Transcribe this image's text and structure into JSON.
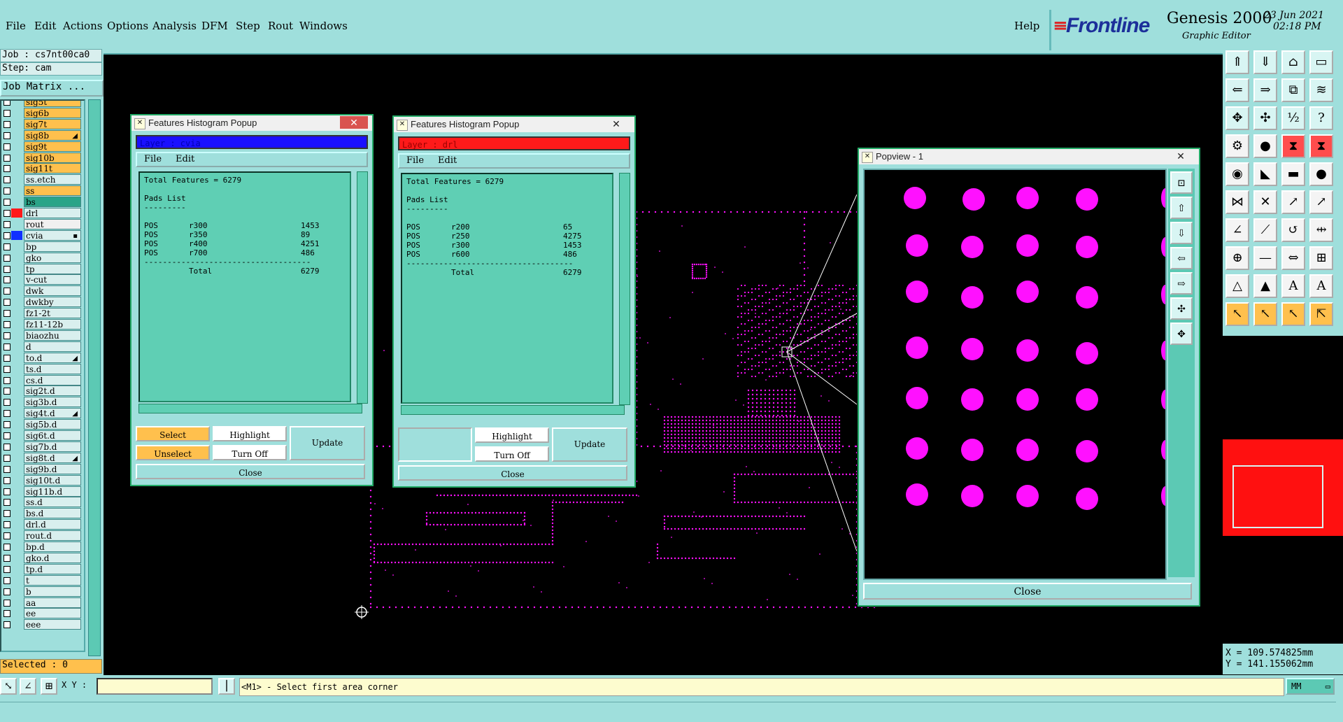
{
  "menu": {
    "items": [
      "File",
      "Edit",
      "Actions",
      "Options",
      "Analysis",
      "DFM",
      "Step",
      "Rout",
      "Windows"
    ],
    "help": "Help"
  },
  "brand": {
    "logo": "Frontline",
    "product": "Genesis 2000",
    "subtitle": "Graphic Editor",
    "date": "23 Jun 2021",
    "time": "02:18 PM"
  },
  "job": {
    "job": "Job : cs7nt00ca0",
    "step": "Step: cam",
    "matrix": "Job Matrix ..."
  },
  "layers": [
    {
      "name": "sig5t",
      "color": "#ffc04d"
    },
    {
      "name": "sig6b",
      "color": "#ffc04d"
    },
    {
      "name": "sig7t",
      "color": "#ffc04d"
    },
    {
      "name": "sig8b",
      "color": "#ffc04d",
      "mark": "◢"
    },
    {
      "name": "sig9t",
      "color": "#ffc04d"
    },
    {
      "name": "sig10b",
      "color": "#ffc04d"
    },
    {
      "name": "sig11t",
      "color": "#ffc04d"
    },
    {
      "name": "ss.etch",
      "color": "#d9efee"
    },
    {
      "name": "ss",
      "color": "#ffc04d"
    },
    {
      "name": "bs",
      "color": "#2aa488"
    },
    {
      "name": "drl",
      "color": "#d9efee",
      "swatch": "#ff1a1a"
    },
    {
      "name": "rout",
      "color": "#f0f0f0"
    },
    {
      "name": "cvia",
      "color": "#d9efee",
      "swatch": "#1030ff",
      "mark": "▪"
    },
    {
      "name": "bp",
      "color": "#d9efee"
    },
    {
      "name": "gko",
      "color": "#d9efee"
    },
    {
      "name": "tp",
      "color": "#d9efee"
    },
    {
      "name": "v-cut",
      "color": "#d9efee"
    },
    {
      "name": "dwk",
      "color": "#d9efee"
    },
    {
      "name": "dwkby",
      "color": "#d9efee"
    },
    {
      "name": "fz1-2t",
      "color": "#d9efee"
    },
    {
      "name": "fz11-12b",
      "color": "#d9efee"
    },
    {
      "name": "biaozhu",
      "color": "#d9efee"
    },
    {
      "name": "d",
      "color": "#d9efee"
    },
    {
      "name": "to.d",
      "color": "#d9efee",
      "mark": "◢"
    },
    {
      "name": "ts.d",
      "color": "#d9efee"
    },
    {
      "name": "cs.d",
      "color": "#d9efee"
    },
    {
      "name": "sig2t.d",
      "color": "#d9efee"
    },
    {
      "name": "sig3b.d",
      "color": "#d9efee"
    },
    {
      "name": "sig4t.d",
      "color": "#d9efee",
      "mark": "◢"
    },
    {
      "name": "sig5b.d",
      "color": "#d9efee"
    },
    {
      "name": "sig6t.d",
      "color": "#d9efee"
    },
    {
      "name": "sig7b.d",
      "color": "#d9efee"
    },
    {
      "name": "sig8t.d",
      "color": "#d9efee",
      "mark": "◢"
    },
    {
      "name": "sig9b.d",
      "color": "#d9efee"
    },
    {
      "name": "sig10t.d",
      "color": "#d9efee"
    },
    {
      "name": "sig11b.d",
      "color": "#d9efee"
    },
    {
      "name": "ss.d",
      "color": "#d9efee"
    },
    {
      "name": "bs.d",
      "color": "#d9efee"
    },
    {
      "name": "drl.d",
      "color": "#d9efee"
    },
    {
      "name": "rout.d",
      "color": "#d9efee"
    },
    {
      "name": "bp.d",
      "color": "#d9efee"
    },
    {
      "name": "gko.d",
      "color": "#d9efee"
    },
    {
      "name": "tp.d",
      "color": "#d9efee"
    },
    {
      "name": "t",
      "color": "#d9efee"
    },
    {
      "name": "b",
      "color": "#d9efee"
    },
    {
      "name": "aa",
      "color": "#d9efee"
    },
    {
      "name": "ee",
      "color": "#d9efee"
    },
    {
      "name": "eee",
      "color": "#d9efee"
    }
  ],
  "selected": "Selected : 0",
  "hist1": {
    "title": "Features Histogram Popup",
    "layer": "Layer :  cvia",
    "layer_color": "#1a10ff",
    "menu_file": "File",
    "menu_edit": "Edit",
    "total_line": "Total Features = 6279",
    "pads_list": "Pads List",
    "underline": "---------",
    "rows": [
      {
        "type": "POS",
        "sym": "r300",
        "count": "1453"
      },
      {
        "type": "POS",
        "sym": "r350",
        "count": "89"
      },
      {
        "type": "POS",
        "sym": "r400",
        "count": "4251"
      },
      {
        "type": "POS",
        "sym": "r700",
        "count": "486"
      }
    ],
    "separator": "------------------------------------",
    "total_label": "Total",
    "total_value": "6279",
    "btn_select": "Select",
    "btn_unselect": "Unselect",
    "btn_highlight": "Highlight",
    "btn_turnoff": "Turn Off",
    "btn_update": "Update",
    "btn_close": "Close"
  },
  "hist2": {
    "title": "Features Histogram Popup",
    "layer": "Layer :  drl",
    "layer_color": "#ff1a1a",
    "menu_file": "File",
    "menu_edit": "Edit",
    "total_line": "Total Features = 6279",
    "pads_list": "Pads List",
    "underline": "---------",
    "rows": [
      {
        "type": "POS",
        "sym": "r200",
        "count": "65"
      },
      {
        "type": "POS",
        "sym": "r250",
        "count": "4275"
      },
      {
        "type": "POS",
        "sym": "r300",
        "count": "1453"
      },
      {
        "type": "POS",
        "sym": "r600",
        "count": "486"
      }
    ],
    "separator": "------------------------------------",
    "total_label": "Total",
    "total_value": "6279",
    "btn_highlight": "Highlight",
    "btn_turnoff": "Turn Off",
    "btn_update": "Update",
    "btn_close": "Close"
  },
  "popview": {
    "title": "Popview - 1",
    "btn_close": "Close"
  },
  "coords": {
    "x": "X = 109.574825mm",
    "y": "Y = 141.155062mm"
  },
  "bottom": {
    "xy_label": "X Y :",
    "prompt": "<M1> - Select first area corner",
    "units": "MM"
  },
  "colors": {
    "panel": "#9fdfdc",
    "feature": "#ff11ff"
  }
}
